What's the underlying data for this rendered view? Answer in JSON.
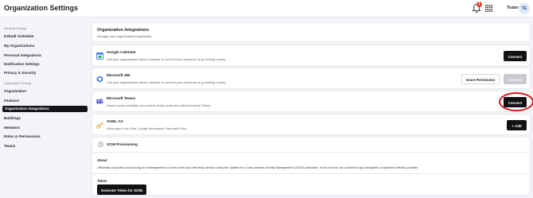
{
  "header": {
    "title": "Organization Settings",
    "notification_count": "1",
    "username": "Tester",
    "avatar_initials": "TE"
  },
  "sidebar": {
    "personal_section": "Personal Settings",
    "personal_items": [
      {
        "label": "Default Schedule"
      },
      {
        "label": "My Organizations"
      },
      {
        "label": "Personal Integrations"
      },
      {
        "label": "Notification Settings"
      },
      {
        "label": "Privacy & Security"
      }
    ],
    "org_section": "Organization Settings",
    "org_items": [
      {
        "label": "Organization"
      },
      {
        "label": "Features"
      },
      {
        "label": "Organization Integrations",
        "active": true
      },
      {
        "label": "Buildings"
      },
      {
        "label": "Members"
      },
      {
        "label": "Roles & Permissions"
      },
      {
        "label": "Teams"
      }
    ]
  },
  "main": {
    "title": "Organization Integrations",
    "subtitle": "Manage your organization integrations.",
    "integrations": [
      {
        "name": "Google Calendar",
        "description": "Link your organizations admin calendar to connect your resources (e.g meeting rooms).",
        "icon": "google-calendar-icon",
        "button": "Connect"
      },
      {
        "name": "Microsoft 365",
        "description": "Link your organizations admin calendar to connect your resources (e.g meeting rooms).",
        "icon": "microsoft-365-icon",
        "secondary_button": "Grant Permission",
        "button": "Connect"
      },
      {
        "name": "Microsoft Teams",
        "description": "Search space available and receive timely reminders without leaving Teams.",
        "icon": "microsoft-teams-icon",
        "button": "Connect"
      },
      {
        "name": "SAML 2.0",
        "description": "Allow sign in via Okta, Google Workspace, Microsoft Entra.",
        "icon": "key-icon",
        "button": "+ Add"
      }
    ],
    "scim": {
      "title": "SCIM Provisioning",
      "about_label": "About",
      "about_text": "Officeship supports provisioning and management of users from your directory service using the System for Cross-domain Identity Management (SCIM) standard. You'll need to use connector app alongside a supported identity provider.",
      "token_label": "Token",
      "generate_button": "Generate Token for SCIM"
    }
  },
  "colors": {
    "accent_dark": "#111214",
    "highlight": "#d11a1a",
    "background": "#f3f4f7"
  }
}
